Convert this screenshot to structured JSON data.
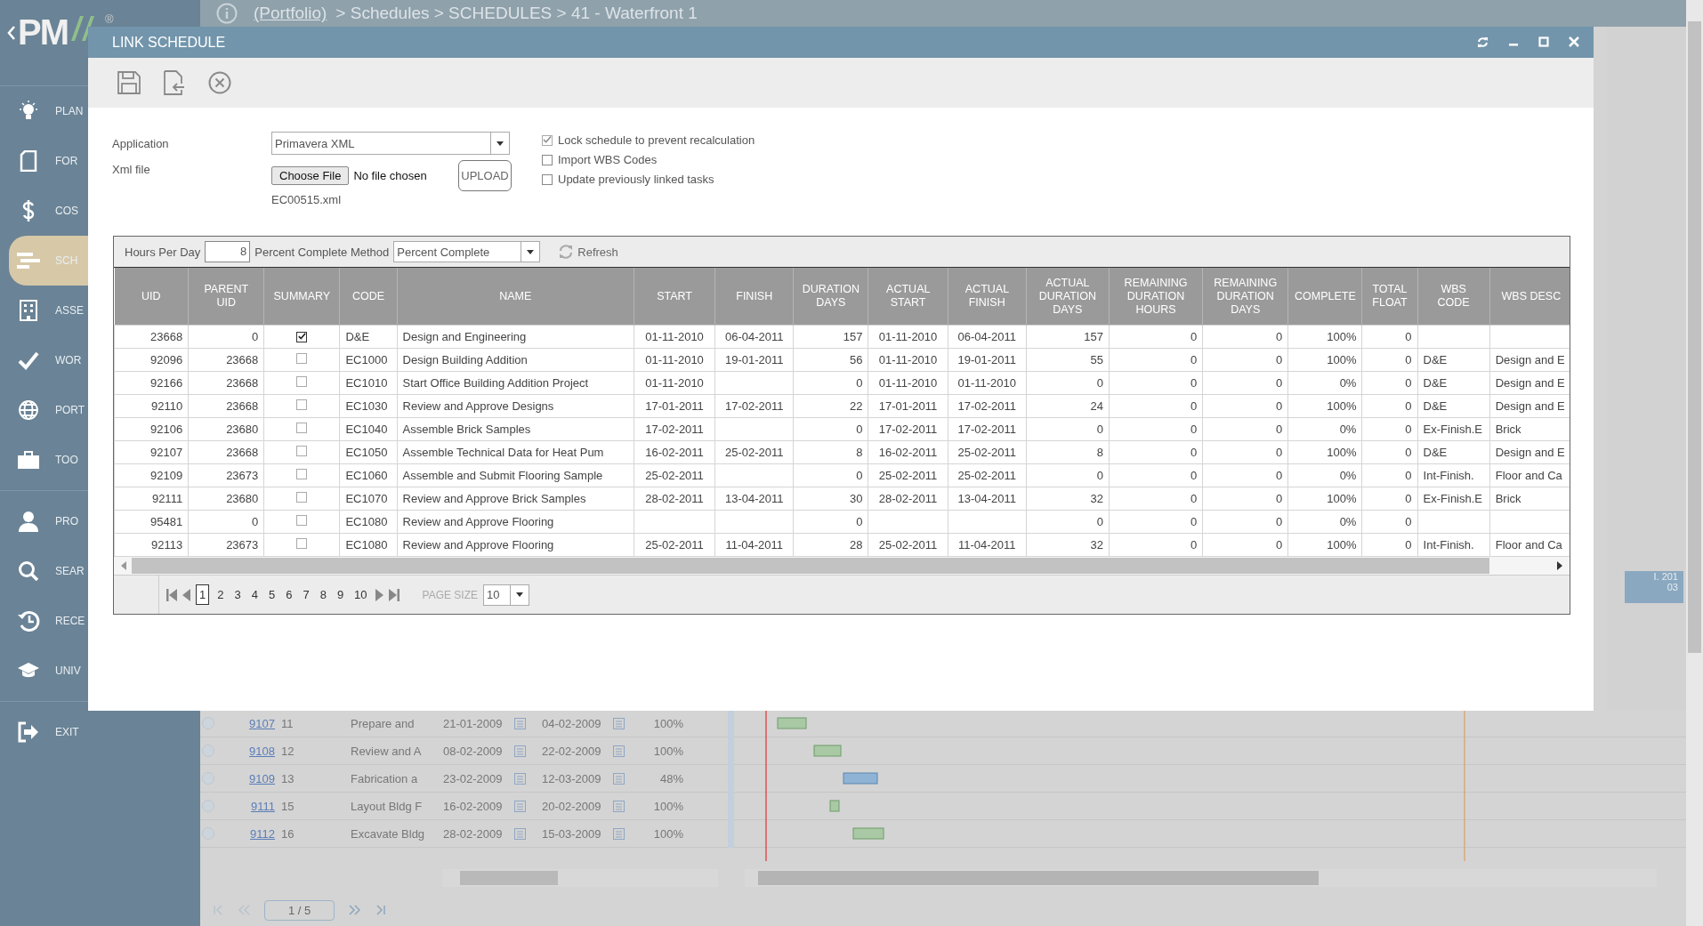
{
  "app": {
    "logo": "PM",
    "logo_mark": "®",
    "nav_groups": [
      [
        {
          "label": "PLAN",
          "kind": "bulb",
          "selected": false
        },
        {
          "label": "FOR",
          "kind": "form",
          "selected": false
        },
        {
          "label": "COS",
          "kind": "cost",
          "selected": false
        },
        {
          "label": "SCH",
          "kind": "schedule",
          "selected": true
        },
        {
          "label": "ASSE",
          "kind": "asset",
          "selected": false
        },
        {
          "label": "WOR",
          "kind": "check",
          "selected": false
        },
        {
          "label": "PORT",
          "kind": "globe",
          "selected": false
        },
        {
          "label": "TOO",
          "kind": "tools",
          "selected": false
        }
      ],
      [
        {
          "label": "PRO",
          "kind": "person",
          "selected": false
        },
        {
          "label": "SEAR",
          "kind": "search",
          "selected": false
        },
        {
          "label": "RECE",
          "kind": "recent",
          "selected": false
        },
        {
          "label": "UNIV",
          "kind": "cap",
          "selected": false
        }
      ],
      [
        {
          "label": "EXIT",
          "kind": "exit",
          "selected": false
        }
      ]
    ]
  },
  "breadcrumb": {
    "link": "(Portfolio)",
    "path": "> Schedules > SCHEDULES > 41 - Waterfront 1"
  },
  "background_grid": {
    "rows": [
      {
        "selected": false,
        "id": "9107",
        "number": "11",
        "name": "Prepare and",
        "start": "21-01-2009",
        "finish": "04-02-2009",
        "percent": "100%"
      },
      {
        "selected": false,
        "id": "9108",
        "number": "12",
        "name": "Review and A",
        "start": "08-02-2009",
        "finish": "22-02-2009",
        "percent": "100%"
      },
      {
        "selected": false,
        "id": "9109",
        "number": "13",
        "name": "Fabrication a",
        "start": "23-02-2009",
        "finish": "12-03-2009",
        "percent": "48%"
      },
      {
        "selected": false,
        "id": "9111",
        "number": "15",
        "name": "Layout Bldg F",
        "start": "16-02-2009",
        "finish": "20-02-2009",
        "percent": "100%"
      },
      {
        "selected": false,
        "id": "9112",
        "number": "16",
        "name": "Excavate Bldg",
        "start": "28-02-2009",
        "finish": "15-03-2009",
        "percent": "100%"
      }
    ],
    "gantt_header": {
      "year": "I. 201",
      "month": "03"
    },
    "pager": "1 / 5"
  },
  "dialog": {
    "title": "LINK SCHEDULE",
    "form": {
      "application_label": "Application",
      "application": "Primavera XML",
      "xml_label": "Xml file",
      "choose_button": "Choose File",
      "no_file": "No file chosen",
      "upload_button": "UPLOAD",
      "file_name": "EC00515.xml",
      "options": [
        {
          "label": "Lock schedule to prevent recalculation",
          "checked": true
        },
        {
          "label": "Import WBS Codes",
          "checked": false
        },
        {
          "label": "Update previously linked tasks",
          "checked": false
        }
      ]
    },
    "grid": {
      "hours_label": "Hours Per Day",
      "hours": "8",
      "method_label": "Percent Complete Method",
      "method": "Percent Complete",
      "refresh": "Refresh",
      "columns": [
        {
          "label": "UID",
          "kind": "text"
        },
        {
          "label": "PARENT UID",
          "kind": "text"
        },
        {
          "label": "SUMMARY",
          "kind": "check"
        },
        {
          "label": "CODE",
          "kind": "text"
        },
        {
          "label": "NAME",
          "kind": "text"
        },
        {
          "label": "START",
          "kind": "text"
        },
        {
          "label": "FINISH",
          "kind": "text"
        },
        {
          "label": "DURATION DAYS",
          "kind": "text"
        },
        {
          "label": "ACTUAL START",
          "kind": "text"
        },
        {
          "label": "ACTUAL FINISH",
          "kind": "text"
        },
        {
          "label": "ACTUAL DURATION DAYS",
          "kind": "text"
        },
        {
          "label": "REMAINING DURATION HOURS",
          "kind": "text"
        },
        {
          "label": "REMAINING DURATION DAYS",
          "kind": "text"
        },
        {
          "label": "COMPLETE",
          "kind": "text"
        },
        {
          "label": "TOTAL FLOAT",
          "kind": "text"
        },
        {
          "label": "WBS CODE",
          "kind": "text"
        },
        {
          "label": "WBS DESC",
          "kind": "text"
        }
      ],
      "rows": [
        {
          "cells": [
            "23668",
            "0",
            true,
            "D&E",
            "Design and Engineering",
            "01-11-2010",
            "06-04-2011",
            "157",
            "01-11-2010",
            "06-04-2011",
            "157",
            "0",
            "0",
            "100%",
            "0",
            null,
            null
          ]
        },
        {
          "cells": [
            "92096",
            "23668",
            false,
            "EC1000",
            "Design Building Addition",
            "01-11-2010",
            "19-01-2011",
            "56",
            "01-11-2010",
            "19-01-2011",
            "55",
            "0",
            "0",
            "100%",
            "0",
            "D&E",
            "Design and E"
          ]
        },
        {
          "cells": [
            "92166",
            "23668",
            false,
            "EC1010",
            "Start Office Building Addition Project",
            "01-11-2010",
            null,
            "0",
            "01-11-2010",
            "01-11-2010",
            "0",
            "0",
            "0",
            "0%",
            "0",
            "D&E",
            "Design and E"
          ]
        },
        {
          "cells": [
            "92110",
            "23668",
            false,
            "EC1030",
            "Review and Approve Designs",
            "17-01-2011",
            "17-02-2011",
            "22",
            "17-01-2011",
            "17-02-2011",
            "24",
            "0",
            "0",
            "100%",
            "0",
            "D&E",
            "Design and E"
          ]
        },
        {
          "cells": [
            "92106",
            "23680",
            false,
            "EC1040",
            "Assemble Brick Samples",
            "17-02-2011",
            null,
            "0",
            "17-02-2011",
            "17-02-2011",
            "0",
            "0",
            "0",
            "0%",
            "0",
            "Ex-Finish.E",
            "Brick"
          ]
        },
        {
          "cells": [
            "92107",
            "23668",
            false,
            "EC1050",
            "Assemble Technical Data for Heat Pum",
            "16-02-2011",
            "25-02-2011",
            "8",
            "16-02-2011",
            "25-02-2011",
            "8",
            "0",
            "0",
            "100%",
            "0",
            "D&E",
            "Design and E"
          ]
        },
        {
          "cells": [
            "92109",
            "23673",
            false,
            "EC1060",
            "Assemble and Submit Flooring Sample",
            "25-02-2011",
            null,
            "0",
            "25-02-2011",
            "25-02-2011",
            "0",
            "0",
            "0",
            "0%",
            "0",
            "Int-Finish.",
            "Floor and Ca"
          ]
        },
        {
          "cells": [
            "92111",
            "23680",
            false,
            "EC1070",
            "Review and Approve Brick Samples",
            "28-02-2011",
            "13-04-2011",
            "30",
            "28-02-2011",
            "13-04-2011",
            "32",
            "0",
            "0",
            "100%",
            "0",
            "Ex-Finish.E",
            "Brick"
          ]
        },
        {
          "cells": [
            "95481",
            "0",
            false,
            "EC1080",
            "Review and Approve Flooring",
            null,
            null,
            "0",
            null,
            null,
            "0",
            "0",
            "0",
            "0%",
            "0",
            null,
            null
          ]
        },
        {
          "cells": [
            "92113",
            "23673",
            false,
            "EC1080",
            "Review and Approve Flooring",
            "25-02-2011",
            "11-04-2011",
            "28",
            "25-02-2011",
            "11-04-2011",
            "32",
            "0",
            "0",
            "100%",
            "0",
            "Int-Finish.",
            "Floor and Ca"
          ]
        }
      ],
      "pages": [
        {
          "label": "1",
          "selected": true
        },
        {
          "label": "2",
          "selected": false
        },
        {
          "label": "3",
          "selected": false
        },
        {
          "label": "4",
          "selected": false
        },
        {
          "label": "5",
          "selected": false
        },
        {
          "label": "6",
          "selected": false
        },
        {
          "label": "7",
          "selected": false
        },
        {
          "label": "8",
          "selected": false
        },
        {
          "label": "9",
          "selected": false
        },
        {
          "label": "10",
          "selected": false
        }
      ],
      "page_size_label": "PAGE SIZE",
      "page_size": "10"
    }
  }
}
